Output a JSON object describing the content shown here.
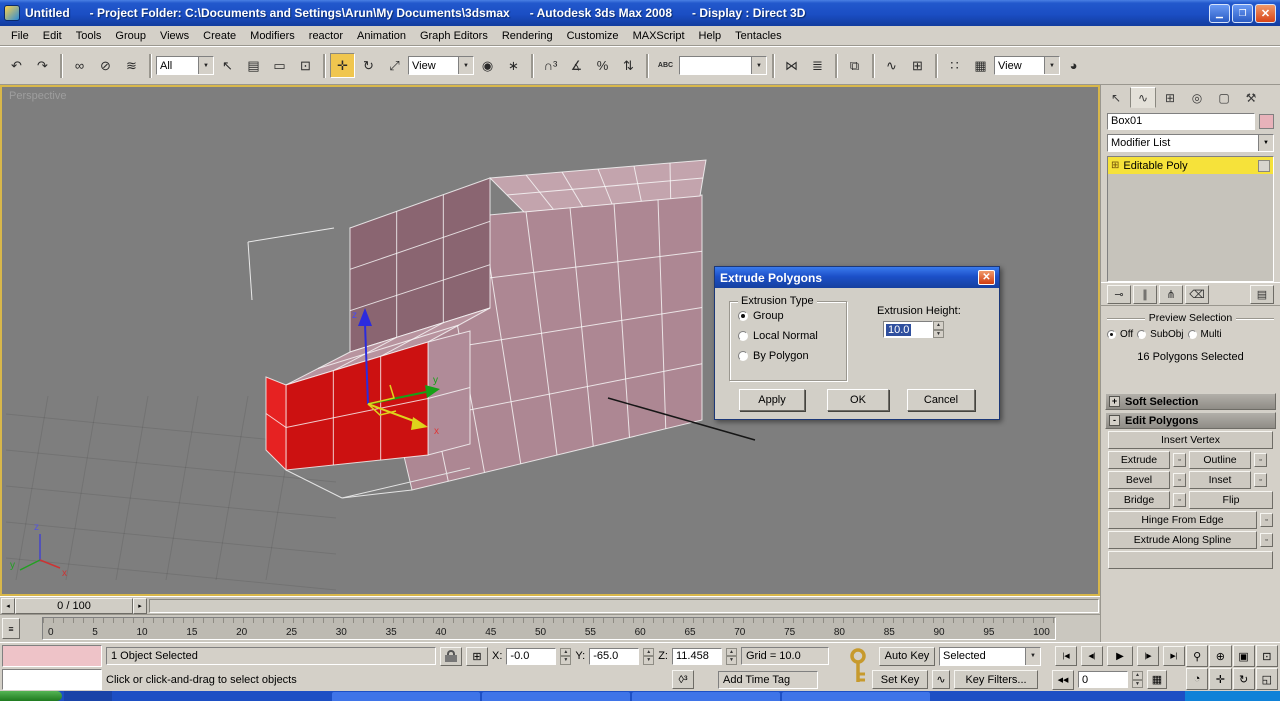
{
  "titlebar": {
    "title": "Untitled      - Project Folder: C:\\Documents and Settings\\Arun\\My Documents\\3dsmax      - Autodesk 3ds Max 2008      - Display : Direct 3D",
    "minimize": "▁",
    "maximize": "❐",
    "close": "✕"
  },
  "menu": {
    "items": [
      "File",
      "Edit",
      "Tools",
      "Group",
      "Views",
      "Create",
      "Modifiers",
      "reactor",
      "Animation",
      "Graph Editors",
      "Rendering",
      "Customize",
      "MAXScript",
      "Help",
      "Tentacles"
    ]
  },
  "glyphs": {
    "combo_arrow": "▼",
    "spin_up": "▲",
    "spin_down": "▼"
  },
  "toolbar": {
    "selection_filter": "All",
    "ref_coord": "View",
    "render_preset": "View",
    "icons": [
      {
        "name": "undo",
        "glyph": "↶"
      },
      {
        "name": "redo",
        "glyph": "↷"
      },
      {
        "name": "select-and-link",
        "glyph": "∞"
      },
      {
        "name": "unlink-selection",
        "glyph": "⊘"
      },
      {
        "name": "bind-to-space-warp",
        "glyph": "≋"
      },
      {
        "name": "select-object",
        "glyph": "↖"
      },
      {
        "name": "select-by-name",
        "glyph": "▤"
      },
      {
        "name": "rectangular-selection-region",
        "glyph": "▭"
      },
      {
        "name": "window-crossing",
        "glyph": "⊡"
      },
      {
        "name": "select-and-move",
        "glyph": "✛"
      },
      {
        "name": "select-and-rotate",
        "glyph": "↻"
      },
      {
        "name": "select-and-uniform-scale",
        "glyph": "⤢"
      },
      {
        "name": "use-pivot-point-center",
        "glyph": "◉"
      },
      {
        "name": "select-and-manipulate",
        "glyph": "∗"
      },
      {
        "name": "snaps-toggle",
        "glyph": "∩³"
      },
      {
        "name": "angle-snap-toggle",
        "glyph": "∡"
      },
      {
        "name": "percent-snap-toggle",
        "glyph": "%"
      },
      {
        "name": "spinner-snap-toggle",
        "glyph": "⇅"
      },
      {
        "name": "edit-named-selection-sets",
        "glyph": "ABC"
      },
      {
        "name": "mirror",
        "glyph": "⋈"
      },
      {
        "name": "align",
        "glyph": "≣"
      },
      {
        "name": "layer-manager",
        "glyph": "⧉"
      },
      {
        "name": "curve-editor",
        "glyph": "∿"
      },
      {
        "name": "schematic-view",
        "glyph": "⊞"
      },
      {
        "name": "material-editor",
        "glyph": "∷"
      },
      {
        "name": "render-setup",
        "glyph": "▦"
      },
      {
        "name": "quick-render",
        "glyph": "◕"
      }
    ]
  },
  "viewport": {
    "label": "Perspective",
    "gizmo_x": "x",
    "gizmo_y": "y",
    "gizmo_z": "z",
    "tripod_x": "x",
    "tripod_y": "y",
    "tripod_z": "z"
  },
  "dialog": {
    "title": "Extrude Polygons",
    "close": "✕",
    "group_label": "Extrusion Type",
    "radio_group": "Group",
    "radio_local_normal": "Local Normal",
    "radio_by_polygon": "By Polygon",
    "height_label": "Extrusion Height:",
    "height_value": "10.0",
    "apply": "Apply",
    "ok": "OK",
    "cancel": "Cancel"
  },
  "command_panel": {
    "tabs": [
      {
        "name": "create",
        "glyph": "↖"
      },
      {
        "name": "modify",
        "glyph": "∿"
      },
      {
        "name": "hierarchy",
        "glyph": "⊞"
      },
      {
        "name": "motion",
        "glyph": "◎"
      },
      {
        "name": "display",
        "glyph": "▢"
      },
      {
        "name": "utilities",
        "glyph": "⚒"
      }
    ],
    "object_name": "Box01",
    "modifier_list_label": "Modifier List",
    "stack_item": "Editable Poly",
    "stack_item_icon": "⊞",
    "stack_tools": [
      {
        "name": "pin-stack",
        "glyph": "⊸"
      },
      {
        "name": "show-end-result",
        "glyph": "∥"
      },
      {
        "name": "make-unique",
        "glyph": "⋔"
      },
      {
        "name": "remove-modifier",
        "glyph": "⌫"
      },
      {
        "name": "configure-modifier-sets",
        "glyph": "▤"
      }
    ],
    "preview_selection_label": "Preview Selection",
    "preview_off": "Off",
    "preview_subobj": "SubObj",
    "preview_multi": "Multi",
    "selection_info": "16 Polygons Selected",
    "soft_selection_toggle": "+",
    "soft_selection_label": "Soft Selection",
    "edit_polygons_toggle": "-",
    "edit_polygons_label": "Edit Polygons",
    "buttons": {
      "insert_vertex": "Insert Vertex",
      "extrude": "Extrude",
      "outline": "Outline",
      "bevel": "Bevel",
      "inset": "Inset",
      "bridge": "Bridge",
      "flip": "Flip",
      "hinge_from_edge": "Hinge From Edge",
      "extrude_along_spline": "Extrude Along Spline",
      "settings_glyph": "▫"
    }
  },
  "timeline": {
    "slider_label": "0 / 100",
    "slider_left": "◂",
    "slider_right": "▸",
    "mini_curve_glyph": "≡",
    "ticks": [
      "0",
      "5",
      "10",
      "15",
      "20",
      "25",
      "30",
      "35",
      "40",
      "45",
      "50",
      "55",
      "60",
      "65",
      "70",
      "75",
      "80",
      "85",
      "90",
      "95",
      "100"
    ]
  },
  "status": {
    "selection_text": "1 Object Selected",
    "x_label": "X:",
    "x_value": "-0.0",
    "y_label": "Y:",
    "y_value": "-65.0",
    "z_label": "Z:",
    "z_value": "11.458",
    "grid_text": "Grid = 10.0",
    "prompt": "Click or click-and-drag to select objects",
    "add_time_tag": "Add Time Tag",
    "auto_key": "Auto Key",
    "set_key": "Set Key",
    "key_filters": "Key Filters...",
    "selection_set_value": "Selected",
    "frame_value": "0",
    "playback": {
      "go_start": "|◀",
      "prev_frame": "◀|",
      "play": "▶",
      "next_frame": "|▶",
      "go_end": "▶|"
    },
    "toggles": {
      "absolute_mode": "⊞",
      "snap_3d": "◊³",
      "rewind": "◀◀",
      "curve_mini": "∿",
      "trackbar": "▦"
    },
    "nav_icons": [
      {
        "name": "zoom",
        "glyph": "⚲"
      },
      {
        "name": "zoom-all",
        "glyph": "⊕"
      },
      {
        "name": "zoom-extents",
        "glyph": "▣"
      },
      {
        "name": "zoom-region",
        "glyph": "⊡"
      },
      {
        "name": "field-of-view",
        "glyph": "◔"
      },
      {
        "name": "pan-view",
        "glyph": "✛"
      },
      {
        "name": "arc-rotate",
        "glyph": "↻"
      },
      {
        "name": "maximize-viewport-toggle",
        "glyph": "◱"
      }
    ]
  }
}
